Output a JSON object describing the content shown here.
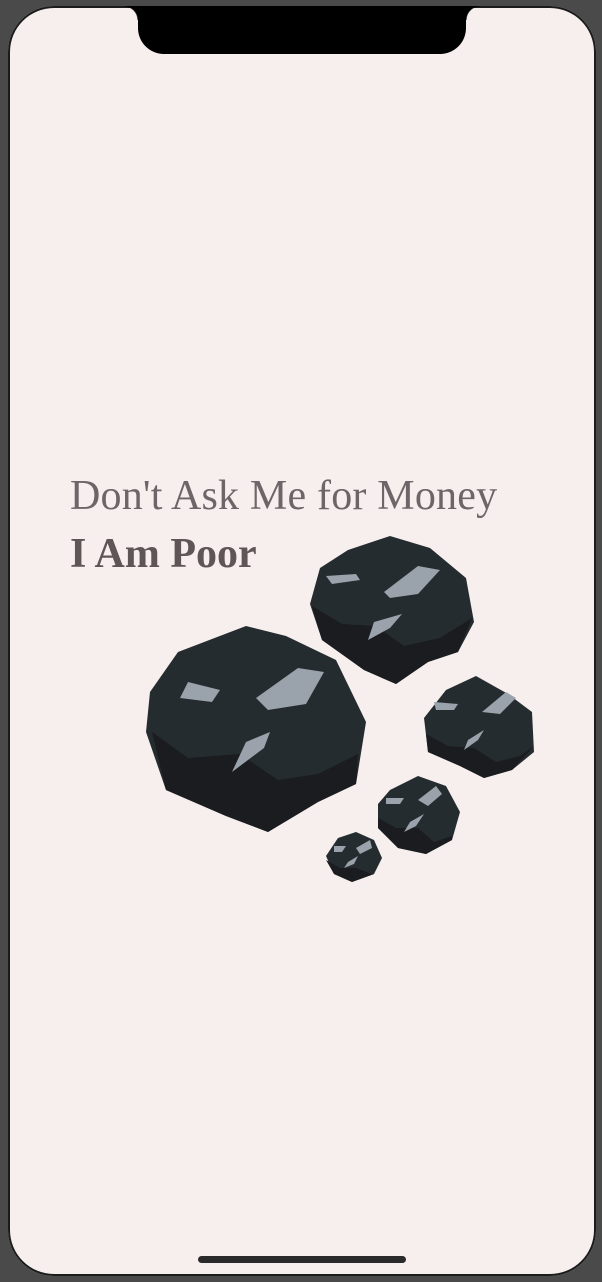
{
  "screen": {
    "background": "#f6efee"
  },
  "content": {
    "headline": "Don't Ask Me for Money",
    "subline": "I Am Poor",
    "headline_color": "#6d6567",
    "subline_color": "#5f5557"
  },
  "illustration": {
    "icon": "coal-lumps-icon",
    "colors": {
      "body": "#252c30",
      "shadow": "#1a1c1f",
      "highlight": "#9aa3ab"
    }
  },
  "system": {
    "home_indicator": "home-indicator"
  }
}
